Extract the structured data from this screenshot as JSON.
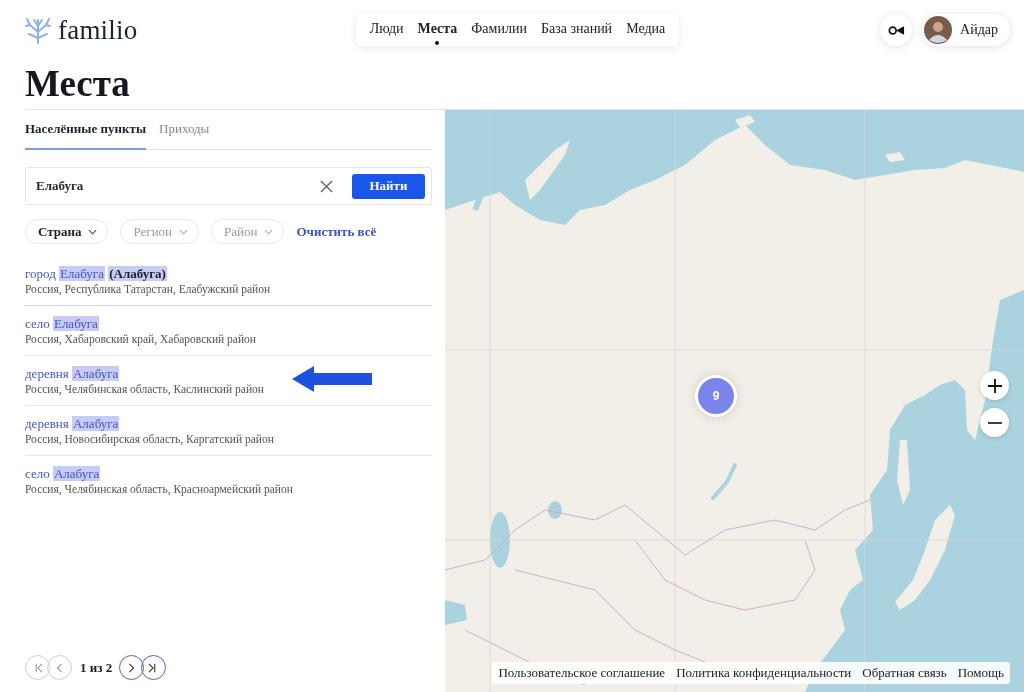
{
  "header": {
    "logo": "familio",
    "nav": [
      {
        "label": "Люди",
        "selected": false
      },
      {
        "label": "Места",
        "selected": true
      },
      {
        "label": "Фамилии",
        "selected": false
      },
      {
        "label": "База знаний",
        "selected": false
      },
      {
        "label": "Медиа",
        "selected": false
      }
    ],
    "user": {
      "name": "Айдар"
    }
  },
  "page_title": "Места",
  "tabs": [
    {
      "label": "Населённые пункты",
      "selected": true
    },
    {
      "label": "Приходы",
      "selected": false
    }
  ],
  "search": {
    "value": "Елабуга",
    "button": "Найти"
  },
  "filters": [
    {
      "label": "Страна",
      "disabled": false
    },
    {
      "label": "Регион",
      "disabled": true
    },
    {
      "label": "Район",
      "disabled": true
    }
  ],
  "clear_filters": "Очистить всё",
  "results": [
    {
      "type": "город",
      "name": "Елабуга",
      "alt_name": "(Алабуга)",
      "location": "Россия, Республика Татарстан, Елабужский район",
      "marked": false
    },
    {
      "type": "село",
      "name": "Елабуга",
      "location": "Россия, Хабаровский край, Хабаровский район",
      "marked": false
    },
    {
      "type": "деревня",
      "name": "Алабуга",
      "location": "Россия, Челябинская область, Каслинский район",
      "marked": true
    },
    {
      "type": "деревня",
      "name": "Алабуга",
      "location": "Россия, Новосибирская область, Каргатский район",
      "marked": false
    },
    {
      "type": "село",
      "name": "Алабуга",
      "location": "Россия, Челябинская область, Красноармейский район",
      "marked": false
    }
  ],
  "pagination": {
    "back": [
      {
        "kind": "first",
        "disabled": true
      },
      {
        "kind": "previous",
        "disabled": true
      }
    ],
    "status": "1 из 2",
    "forward": [
      {
        "kind": "next",
        "disabled": false
      },
      {
        "kind": "last",
        "disabled": false
      }
    ]
  },
  "map": {
    "cluster": {
      "count": "9"
    },
    "footer_links": [
      "Пользовательское соглашение",
      "Политика конфиденциальности",
      "Обратная связь",
      "Помощь"
    ]
  }
}
